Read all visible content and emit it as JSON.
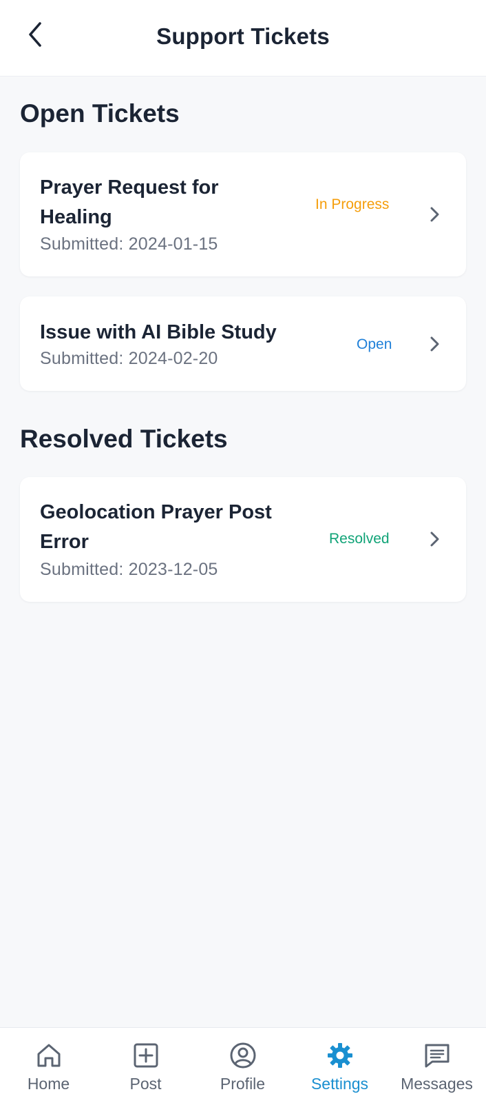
{
  "header": {
    "title": "Support Tickets",
    "back_icon": "chevron-left-icon"
  },
  "sections": {
    "open": {
      "title": "Open Tickets",
      "tickets": [
        {
          "title": "Prayer Request for Healing",
          "submitted": "Submitted: 2024-01-15",
          "status": "In Progress",
          "status_color": "#f59e0b"
        },
        {
          "title": "Issue with AI Bible Study",
          "submitted": "Submitted: 2024-02-20",
          "status": "Open",
          "status_color": "#1e7fd8"
        }
      ]
    },
    "resolved": {
      "title": "Resolved Tickets",
      "tickets": [
        {
          "title": "Geolocation Prayer Post Error",
          "submitted": "Submitted: 2023-12-05",
          "status": "Resolved",
          "status_color": "#10a377"
        }
      ]
    }
  },
  "nav": {
    "active": "Settings",
    "active_color": "#1a8fd0",
    "items": [
      {
        "label": "Home",
        "icon": "home-icon"
      },
      {
        "label": "Post",
        "icon": "plus-square-icon"
      },
      {
        "label": "Profile",
        "icon": "user-circle-icon"
      },
      {
        "label": "Settings",
        "icon": "gear-icon"
      },
      {
        "label": "Messages",
        "icon": "message-icon"
      }
    ]
  }
}
